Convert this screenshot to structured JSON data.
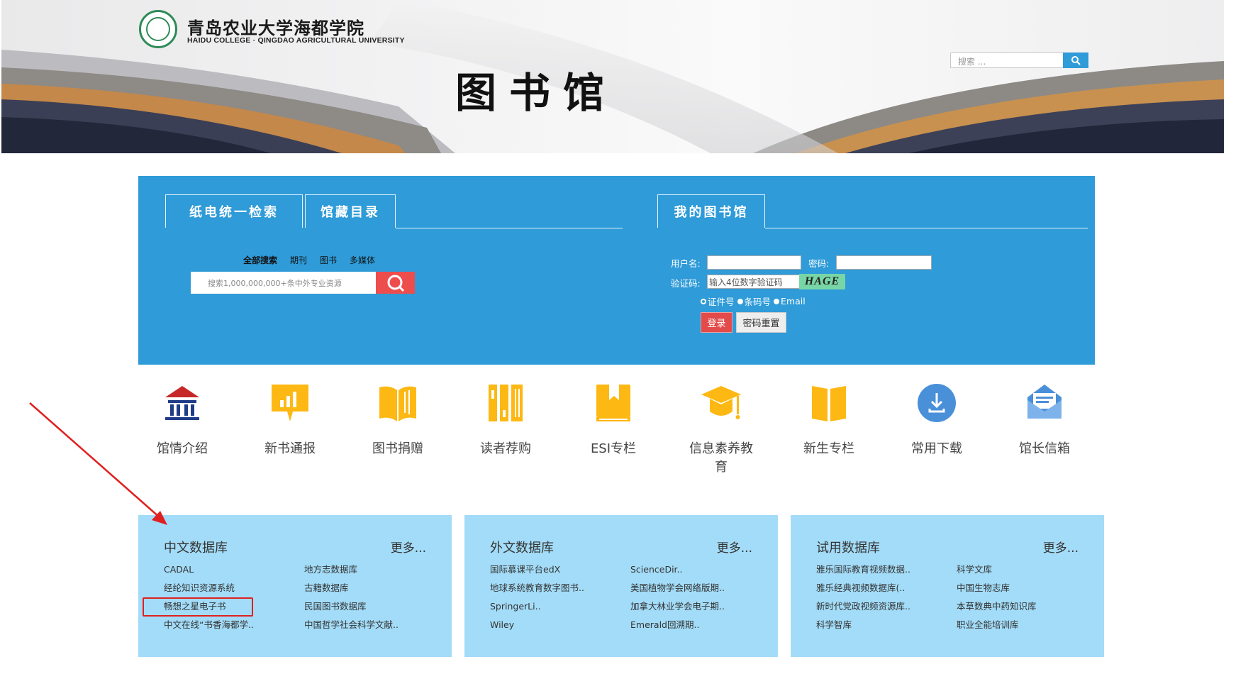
{
  "header": {
    "school_cn": "青岛农业大学海都学院",
    "school_en": "HAIDU COLLEGE · QINGDAO AGRICULTURAL UNIVERSITY",
    "site_title": "图书馆",
    "search_placeholder": "搜索 ..."
  },
  "search_panel": {
    "tabs": [
      "纸电统一检索",
      "馆藏目录"
    ],
    "types": [
      "全部搜索",
      "期刊",
      "图书",
      "多媒体"
    ],
    "placeholder": "搜索1,000,000,000+条中外专业资源"
  },
  "library": {
    "tab": "我的图书馆",
    "username_label": "用户名:",
    "password_label": "密码:",
    "captcha_label": "验证码:",
    "captcha_placeholder": "输入4位数字验证码",
    "captcha_text": "HAGE",
    "radio_options": [
      "证件号",
      "条码号",
      "Email"
    ],
    "login_button": "登录",
    "reset_button": "密码重置"
  },
  "quick_links": [
    {
      "label": "馆情介绍",
      "icon": "library-building-icon"
    },
    {
      "label": "新书通报",
      "icon": "chart-board-icon"
    },
    {
      "label": "图书捐赠",
      "icon": "open-book-icon"
    },
    {
      "label": "读者荐购",
      "icon": "bookshelf-icon"
    },
    {
      "label": "ESI专栏",
      "icon": "bookmark-book-icon"
    },
    {
      "label": "信息素养教育",
      "icon": "graduation-cap-icon"
    },
    {
      "label": "新生专栏",
      "icon": "book-icon"
    },
    {
      "label": "常用下载",
      "icon": "download-icon"
    },
    {
      "label": "馆长信箱",
      "icon": "mail-icon"
    }
  ],
  "databases": [
    {
      "title": "中文数据库",
      "more": "更多...",
      "items": [
        "CADAL",
        "地方志数据库",
        "经纶知识资源系统",
        "古籍数据库",
        "畅想之星电子书",
        "民国图书数据库",
        "中文在线“书香海都学..",
        "中国哲学社会科学文献.."
      ]
    },
    {
      "title": "外文数据库",
      "more": "更多...",
      "items": [
        "国际慕课平台edX",
        "ScienceDir..",
        "地球系统教育数字图书..",
        "美国植物学会网络版期..",
        "SpringerLi..",
        "加拿大林业学会电子期..",
        "Wiley",
        "Emerald回溯期.."
      ]
    },
    {
      "title": "试用数据库",
      "more": "更多...",
      "items": [
        "雅乐国际教育视频数据..",
        "科学文库",
        "雅乐经典视频数据库(..",
        "中国生物志库",
        "新时代党政视频资源库..",
        "本草数典中药知识库",
        "科学智库",
        "职业全能培训库"
      ]
    }
  ],
  "colors": {
    "panel_blue": "#2f9bd8",
    "db_box": "#a3dcf8",
    "icon_yellow": "#fdb813",
    "icon_red": "#c62828",
    "icon_navy": "#1f3c88",
    "annotation_red": "#e02020"
  }
}
